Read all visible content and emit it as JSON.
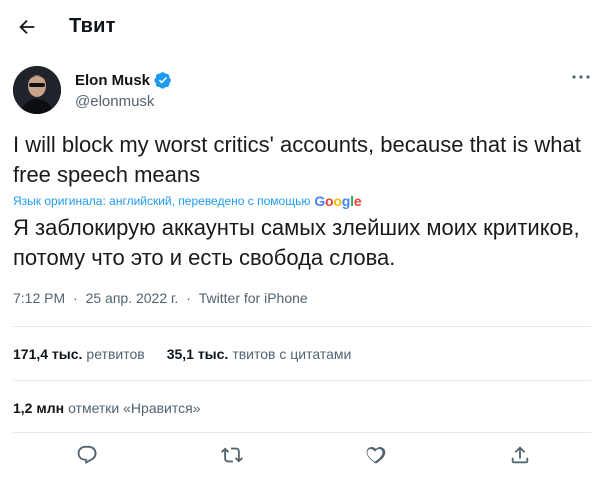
{
  "header": {
    "title": "Твит"
  },
  "author": {
    "name": "Elon Musk",
    "handle": "@elonmusk"
  },
  "tweet": {
    "text": "I will block my worst critics' accounts, because that is what free speech means",
    "translation_note": "Язык оригинала: английский, переведено с помощью",
    "translation_provider": "Google",
    "translated_text": "Я заблокирую аккаунты самых злейших моих критиков, потому что это и есть свобода слова."
  },
  "meta": {
    "time": "7:12 PM",
    "date": "25 апр. 2022 г.",
    "source": "Twitter for iPhone",
    "separator": "·"
  },
  "stats": {
    "retweets_count": "171,4 тыс.",
    "retweets_label": "ретвитов",
    "quotes_count": "35,1 тыс.",
    "quotes_label": "твитов с цитатами",
    "likes_count": "1,2 млн",
    "likes_label": "отметки «Нравится»"
  },
  "icons": {
    "back": "arrow-left-icon",
    "verified": "verified-badge-icon",
    "more": "more-icon",
    "reply": "reply-icon",
    "retweet": "retweet-icon",
    "like": "heart-icon",
    "share": "share-icon"
  },
  "colors": {
    "accent": "#1d9bf0",
    "text": "#0f1419",
    "secondary": "#536471",
    "divider": "#e5e8eb"
  }
}
